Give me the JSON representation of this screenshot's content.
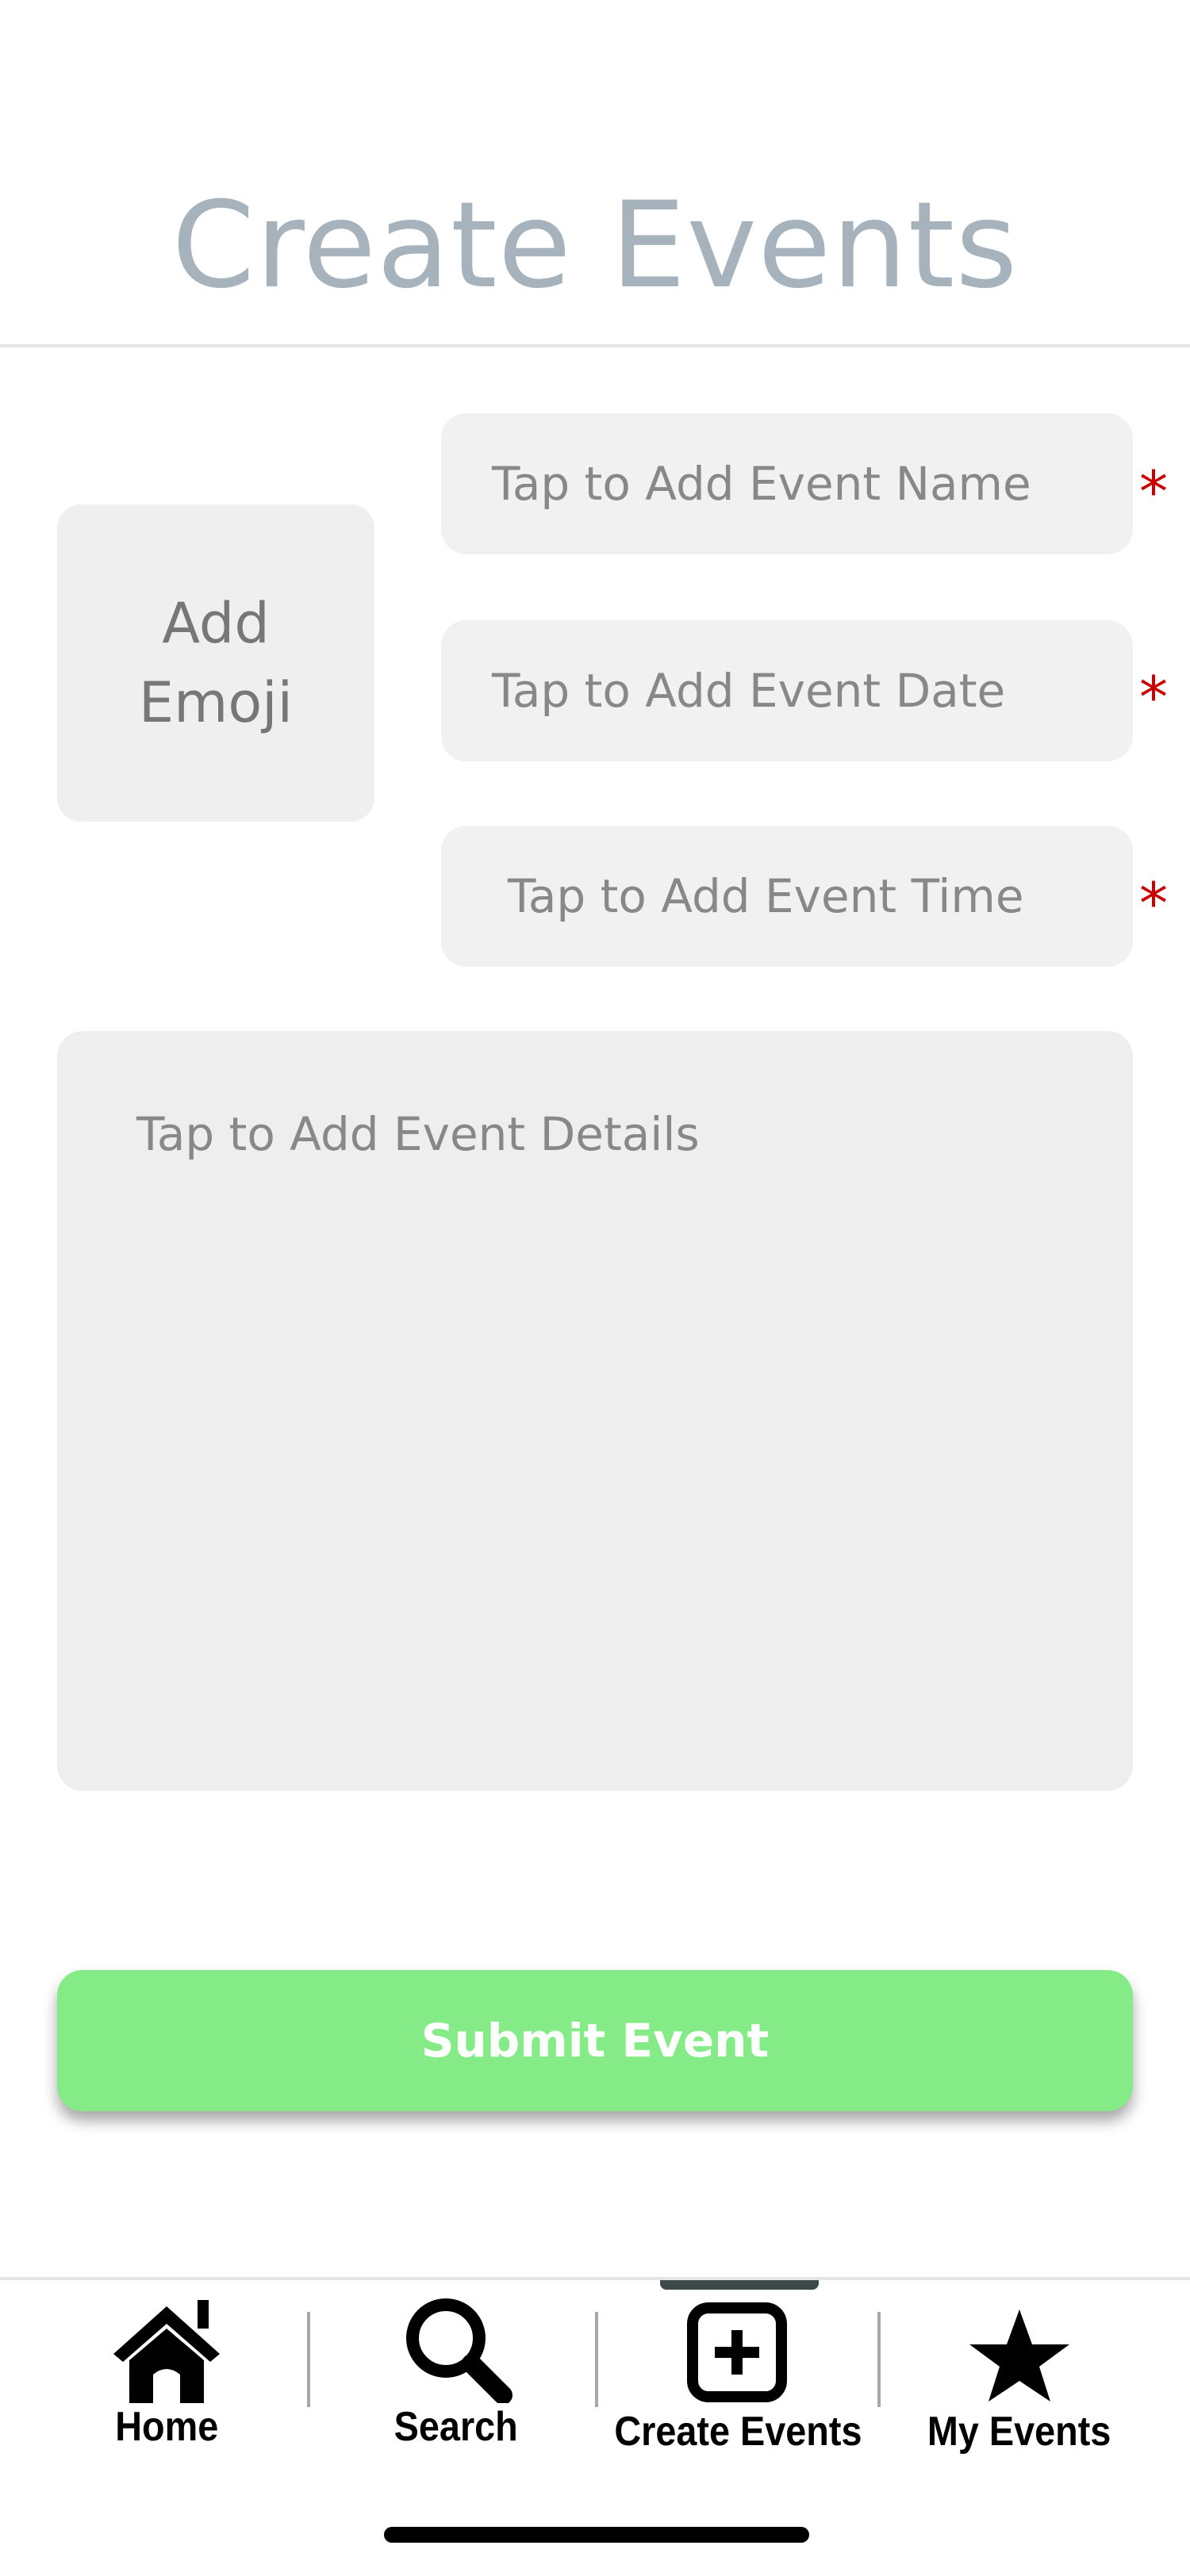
{
  "header": {
    "title": "Create Events"
  },
  "form": {
    "emoji_label": "Add Emoji",
    "event_name_placeholder": "Tap to Add Event Name",
    "event_date_placeholder": "Tap to Add Event Date",
    "event_time_placeholder": "Tap to Add Event Time",
    "details_placeholder": "Tap to Add Event Details",
    "required_marker": "*",
    "submit_label": "Submit Event"
  },
  "colors": {
    "title": "#a6b2bc",
    "field_background": "#f1f1f1",
    "required": "#c80000",
    "submit": "#84eb86"
  },
  "nav": {
    "active": "Create Events",
    "items": [
      {
        "label": "Home",
        "icon": "home-icon"
      },
      {
        "label": "Search",
        "icon": "search-icon"
      },
      {
        "label": "Create Events",
        "icon": "plus-square-icon"
      },
      {
        "label": "My Events",
        "icon": "star-icon"
      }
    ]
  }
}
